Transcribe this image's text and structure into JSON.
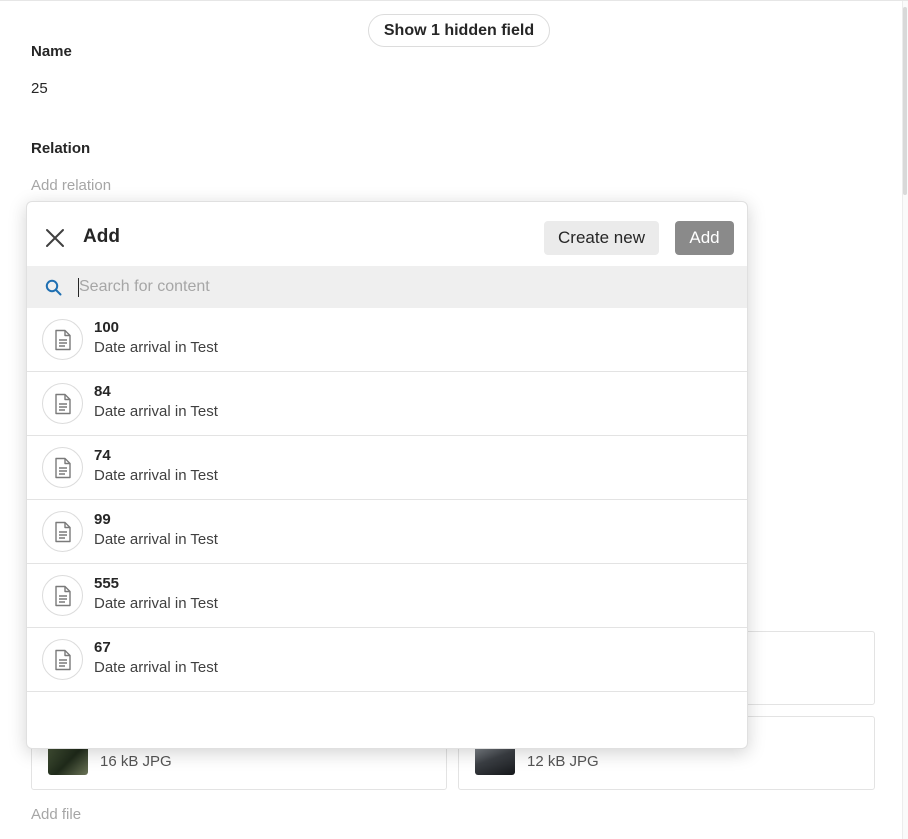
{
  "form": {
    "show_hidden_label": "Show 1 hidden field",
    "name_label": "Name",
    "name_value": "25",
    "relation_label": "Relation",
    "add_relation_label": "Add relation",
    "files": [
      {
        "meta": "16 kB JPG"
      },
      {
        "meta": "12 kB JPG"
      }
    ],
    "add_file_label": "Add file"
  },
  "modal": {
    "title": "Add",
    "create_new_label": "Create new",
    "add_label": "Add",
    "search_placeholder": "Search for content",
    "search_value": "",
    "close_icon": "close-icon",
    "search_icon": "search-icon",
    "row_icon": "document-icon",
    "results": [
      {
        "title": "100",
        "subtitle": "Date arrival in Test"
      },
      {
        "title": "84",
        "subtitle": "Date arrival in Test"
      },
      {
        "title": "74",
        "subtitle": "Date arrival in Test"
      },
      {
        "title": "99",
        "subtitle": "Date arrival in Test"
      },
      {
        "title": "555",
        "subtitle": "Date arrival in Test"
      },
      {
        "title": "67",
        "subtitle": "Date arrival in Test"
      }
    ]
  },
  "colors": {
    "add_button_bg": "#8a8a8a",
    "create_new_bg": "#ebebeb",
    "search_bar_bg": "#efefef",
    "search_icon": "#1f6fb2",
    "placeholder_text": "#a6a6a6"
  }
}
